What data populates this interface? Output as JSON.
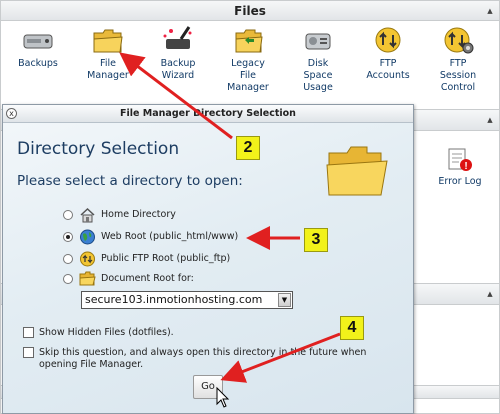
{
  "files_panel": {
    "title": "Files",
    "apps": [
      {
        "label": "Backups",
        "icon": "backups-drive-icon"
      },
      {
        "label": "File Manager",
        "icon": "folder-icon"
      },
      {
        "label": "Backup Wizard",
        "icon": "wizard-wand-icon"
      },
      {
        "label": "Legacy File Manager",
        "icon": "legacy-folder-icon"
      },
      {
        "label": "Disk Space Usage",
        "icon": "disk-icon"
      },
      {
        "label": "FTP Accounts",
        "icon": "ftp-accounts-icon"
      },
      {
        "label": "FTP Session Control",
        "icon": "ftp-session-icon"
      }
    ],
    "right_item": {
      "label": "Error Log",
      "icon": "error-log-icon"
    }
  },
  "dialog": {
    "titlebar": "File Manager Directory Selection",
    "close_symbol": "x",
    "heading": "Directory Selection",
    "prompt": "Please select a directory to open:",
    "options": [
      {
        "label": "Home Directory",
        "checked": false,
        "icon": "home-icon"
      },
      {
        "label": "Web Root (public_html/www)",
        "checked": true,
        "icon": "globe-icon"
      },
      {
        "label": "Public FTP Root (public_ftp)",
        "checked": false,
        "icon": "ftp-icon"
      },
      {
        "label": "Document Root for:",
        "checked": false,
        "icon": "folder-icon"
      }
    ],
    "domain_select": {
      "value": "secure103.inmotionhosting.com"
    },
    "checkboxes": [
      {
        "label": "Show Hidden Files (dotfiles).",
        "checked": false
      },
      {
        "label": "Skip this question, and always open this directory in the future when opening File Manager.",
        "checked": false
      }
    ],
    "go_button": "Go"
  },
  "annotations": [
    {
      "number": "2"
    },
    {
      "number": "3"
    },
    {
      "number": "4"
    }
  ],
  "colors": {
    "arrow": "#e02020",
    "badge": "#f2f21a",
    "link_text": "#113a66",
    "dialog_heading": "#1d3d62"
  }
}
